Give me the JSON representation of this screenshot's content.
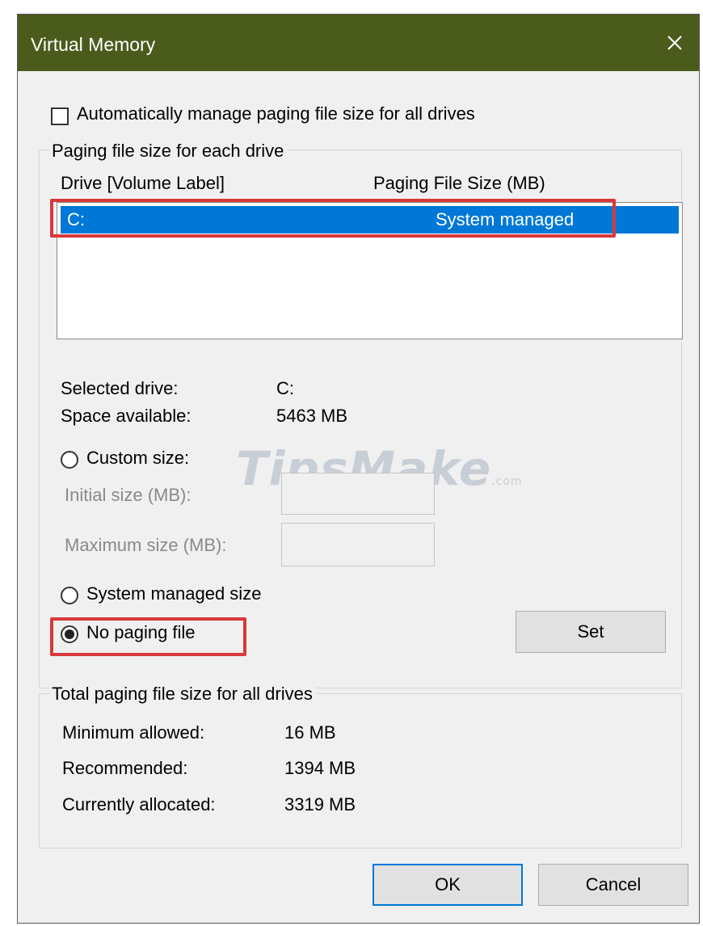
{
  "window": {
    "title": "Virtual Memory"
  },
  "auto_manage": {
    "label": "Automatically manage paging file size for all drives",
    "checked": false
  },
  "paging_group": {
    "legend": "Paging file size for each drive",
    "col_drive": "Drive  [Volume Label]",
    "col_size": "Paging File Size (MB)",
    "rows": [
      {
        "drive": "C:",
        "size": "System managed",
        "selected": true
      }
    ]
  },
  "selected_drive": {
    "drive_label": "Selected drive:",
    "drive_value": "C:",
    "space_label": "Space available:",
    "space_value": "5463 MB"
  },
  "options": {
    "custom_size_label": "Custom size:",
    "initial_label": "Initial size (MB):",
    "initial_value": "",
    "maximum_label": "Maximum size (MB):",
    "maximum_value": "",
    "system_managed_label": "System managed size",
    "no_paging_label": "No paging file",
    "selected": "no_paging",
    "set_label": "Set"
  },
  "watermark": {
    "text_main": "TipsMake",
    "text_suffix": ".com"
  },
  "totals_group": {
    "legend": "Total paging file size for all drives",
    "min_label": "Minimum allowed:",
    "min_value": "16 MB",
    "rec_label": "Recommended:",
    "rec_value": "1394 MB",
    "alloc_label": "Currently allocated:",
    "alloc_value": "3319 MB"
  },
  "footer": {
    "ok_label": "OK",
    "cancel_label": "Cancel"
  },
  "colors": {
    "titlebar": "#4a5b1c",
    "selection": "#0078d7",
    "highlight_box": "#d9383b"
  }
}
